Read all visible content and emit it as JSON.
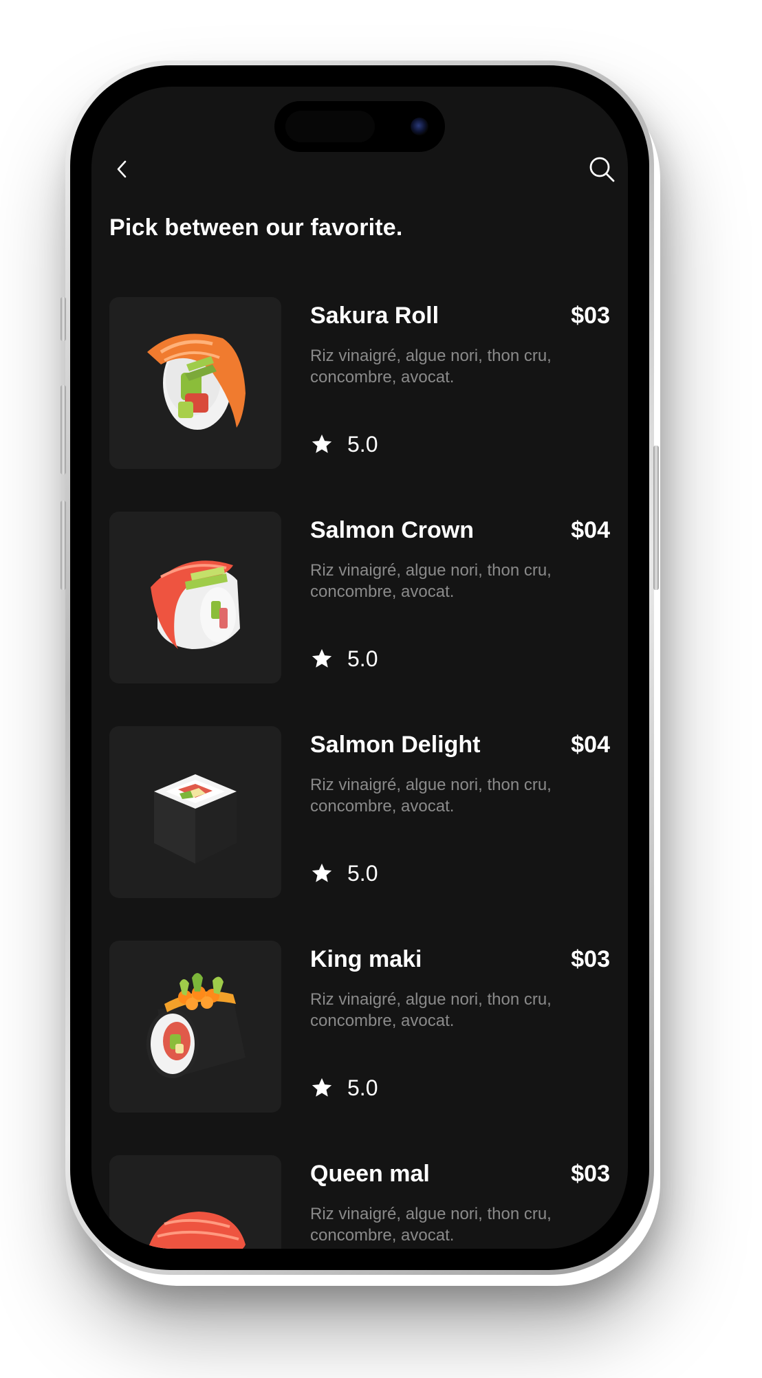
{
  "header": {
    "title": "Pick between our favorite.",
    "back_icon": "chevron-left-icon",
    "search_icon": "search-icon"
  },
  "menu": {
    "items": [
      {
        "name": "Sakura Roll",
        "price": "$03",
        "description": "Riz vinaigré, algue nori, thon cru, concombre, avocat.",
        "rating": "5.0",
        "image": "salmon-nigiri-roll-illustration"
      },
      {
        "name": "Salmon Crown",
        "price": "$04",
        "description": "Riz vinaigré, algue nori, thon cru, concombre, avocat.",
        "rating": "5.0",
        "image": "salmon-crown-roll-illustration"
      },
      {
        "name": "Salmon Delight",
        "price": "$04",
        "description": "Riz vinaigré, algue nori, thon cru, concombre, avocat.",
        "rating": "5.0",
        "image": "nori-maki-illustration"
      },
      {
        "name": "King maki",
        "price": "$03",
        "description": "Riz vinaigré, algue nori, thon cru, concombre, avocat.",
        "rating": "5.0",
        "image": "king-maki-illustration"
      },
      {
        "name": "Queen mal",
        "price": "$03",
        "description": "Riz vinaigré, algue nori, thon cru, concombre, avocat.",
        "rating": "",
        "image": "tuna-nigiri-illustration"
      }
    ]
  },
  "colors": {
    "background": "#141414",
    "card": "#1f1f1f",
    "text_primary": "#ffffff",
    "text_secondary": "#8a8a8a"
  }
}
